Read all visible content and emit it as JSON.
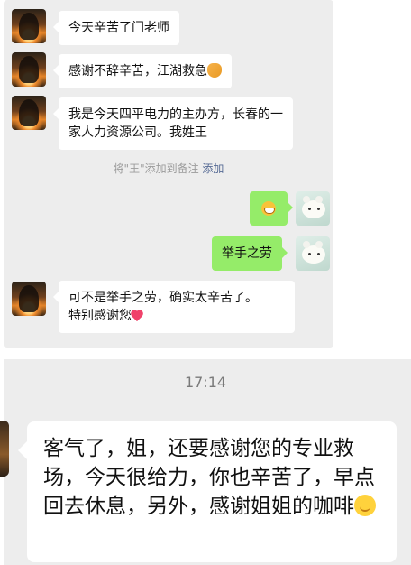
{
  "chat": {
    "messages": [
      {
        "side": "left",
        "text": "今天辛苦了门老师"
      },
      {
        "side": "left",
        "text": "感谢不辞辛苦，江湖救急",
        "emoji": "folded-hands"
      },
      {
        "side": "left",
        "text": "我是今天四平电力的主办方，长春的一家人力资源公司。我姓王"
      },
      {
        "side": "right",
        "emoji": "grinning-face"
      },
      {
        "side": "right",
        "text": "举手之劳"
      },
      {
        "side": "left",
        "text_line1": "可不是举手之劳，确实太辛苦了。",
        "text_line2": "特别感谢您",
        "emoji": "heart"
      }
    ],
    "system_notice": {
      "text": "将\"王\"添加到备注",
      "link": "添加"
    }
  },
  "second_screen": {
    "time": "17:14",
    "message": "客气了，姐，还要感谢您的专业救场，今天很给力，你也辛苦了，早点回去休息，另外，感谢姐姐的咖啡",
    "emoji": "smiling-face"
  },
  "colors": {
    "background": "#ededed",
    "incoming_bubble": "#ffffff",
    "outgoing_bubble": "#95ec69",
    "link": "#576b95"
  }
}
